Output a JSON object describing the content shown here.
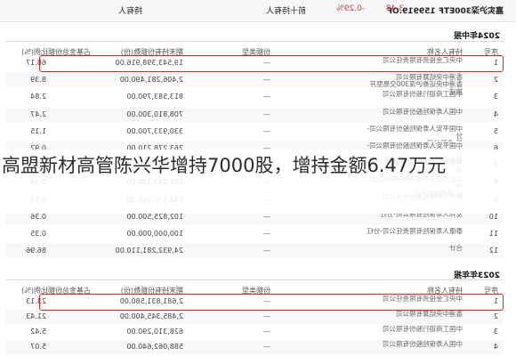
{
  "top_bar": {
    "fund": "嘉实沪深300ETF 159919.OF",
    "price": "3.48",
    "change": "-0.29%",
    "tab_holders": "前十持有人",
    "tab_holders_short": "持有人"
  },
  "section_2024": {
    "title": "2024年中报",
    "headers": {
      "seq": "序号",
      "name": "持有人名称",
      "type": "份额类型",
      "shares": "期末持有份额数(份)",
      "ratio": "占基金总份额比例(%)"
    },
    "rows": [
      {
        "seq": "1",
        "name": "中央汇金投资有限责任公司",
        "type": "—",
        "shares": "19,543,398,916.00",
        "ratio": "68.17"
      },
      {
        "seq": "2",
        "name": "香港中央结算有限公司\n香港中央证券沪深300交易型开放式",
        "type": "—",
        "shares": "2,406,281,490.00",
        "ratio": "8.39"
      },
      {
        "seq": "3",
        "name": "中国工商银行股份有限公司",
        "type": "—",
        "shares": "813,583,790.00",
        "ratio": "2.84"
      },
      {
        "seq": "4",
        "name": "中国人寿保险股份有限公司",
        "type": "—",
        "shares": "708,810,300.00",
        "ratio": "2.47"
      },
      {
        "seq": "5",
        "name": "中国平安人寿保险股份有限公司-分\n红-个险分红",
        "type": "—",
        "shares": "330,933,700.00",
        "ratio": "1.15"
      },
      {
        "seq": "6",
        "name": "中国平安人寿保险股份有限公司-自\n有资金",
        "type": "—",
        "shares": "263,278,210.00",
        "ratio": "0.92"
      },
      {
        "seq": "7",
        "name": "中国太平洋人寿保险股份有限公司",
        "type": "—",
        "shares": "215,193,700.00",
        "ratio": "0.75"
      },
      {
        "seq": "8",
        "name": "中国平安人寿保险股份有限公司-传\n统-普通保险产品",
        "type": "—",
        "shares": "165,047,190.00",
        "ratio": "0.58"
      },
      {
        "seq": "9",
        "name": "新华人寿保险股份有限公司",
        "type": "—",
        "shares": "143,530,100.00",
        "ratio": "0.50"
      },
      {
        "seq": "10",
        "name": "友邦人寿保险有限公司-分红",
        "type": "—",
        "shares": "102,825,500.00",
        "ratio": "0.36"
      },
      {
        "seq": "11",
        "name": "泰康人寿保险有限责任公司-分红",
        "type": "—",
        "shares": "100,000,000.00",
        "ratio": "0.35"
      },
      {
        "seq": "12",
        "name": "合计",
        "type": "—",
        "shares": "24,932,281,110.00",
        "ratio": "86.96"
      }
    ]
  },
  "section_2023": {
    "title": "2023年年报",
    "headers": {
      "seq": "序号",
      "name": "持有人名称",
      "type": "份额类型",
      "shares": "期末持有份额数(份)",
      "ratio": "占基金总份额比例(%)"
    },
    "rows": [
      {
        "seq": "1",
        "name": "中央汇金投资有限责任公司",
        "type": "—",
        "shares": "2,681,831,580.00",
        "ratio": "23.13"
      },
      {
        "seq": "2",
        "name": "香港中央结算有限公司",
        "type": "—",
        "shares": "2,485,345,400.00",
        "ratio": "21.43"
      },
      {
        "seq": "3",
        "name": "中国工商银行股份有限公司",
        "type": "—",
        "shares": "628,310,290.00",
        "ratio": "5.42"
      },
      {
        "seq": "4",
        "name": "中国人寿保险股份有限公司",
        "type": "—",
        "shares": "588,062,640.00",
        "ratio": "5.07"
      }
    ]
  },
  "headline": "高盟新材高管陈兴华增持7000股，增持金额6.47万元"
}
